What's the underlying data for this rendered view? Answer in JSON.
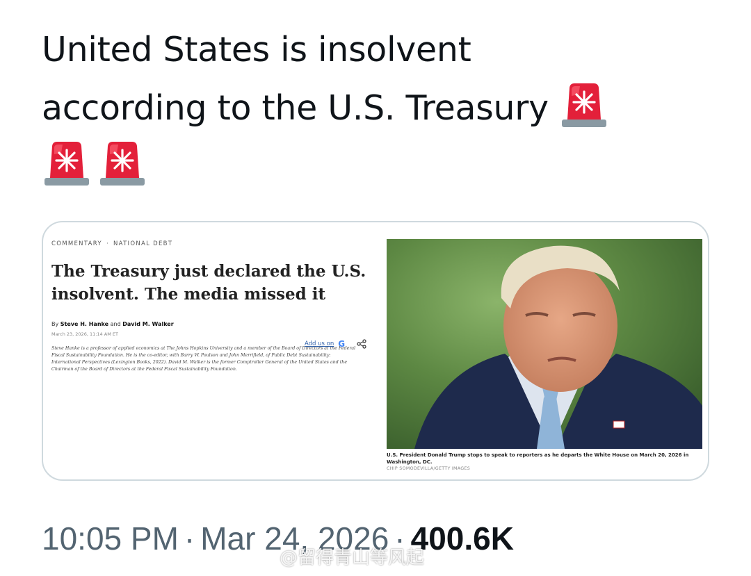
{
  "tweet": {
    "text_line1": "United States is insolvent",
    "text_line2": "according to the U.S. Treasury",
    "emoji_name": "police-car-light-icon",
    "emoji_count": 3,
    "timestamp": "10:05 PM",
    "date": "Mar 24, 2026",
    "separator": "·",
    "views": "400.6K"
  },
  "article": {
    "section": "COMMENTARY",
    "topic": "NATIONAL DEBT",
    "headline": "The Treasury just declared the U.S. insolvent. The media missed it",
    "byline_prefix": "By",
    "author1": "Steve H. Hanke",
    "byline_and": "and",
    "author2": "David M. Walker",
    "date": "March 23, 2026, 11:14 AM ET",
    "add_us_label": "Add us on",
    "google_icon": "G",
    "bio": "Steve Hanke is a professor of applied economics at The Johns Hopkins University and a member of the Board of Directors at the Federal Fiscal Sustainability Foundation. He is the co-editor, with Barry W. Poulson and John Merrifield, of Public Debt Sustainability: International Perspectives (Lexington Books, 2022). David M. Walker is the former Comptroller General of the United States and the Chairman of the Board of Directors at the Federal Fiscal Sustainability Foundation."
  },
  "photo": {
    "caption": "U.S. President Donald Trump stops to speak to reporters as he departs the White House on March 20, 2026 in Washington, DC.",
    "credit": "CHIP SOMODEVILLA/GETTY IMAGES"
  },
  "watermark": "@留得青山等风起",
  "colors": {
    "text": "#0f1419",
    "muted": "#536471",
    "card_border": "#cfd9de",
    "siren_red": "#e3203a",
    "siren_base": "#8a9aa3"
  }
}
